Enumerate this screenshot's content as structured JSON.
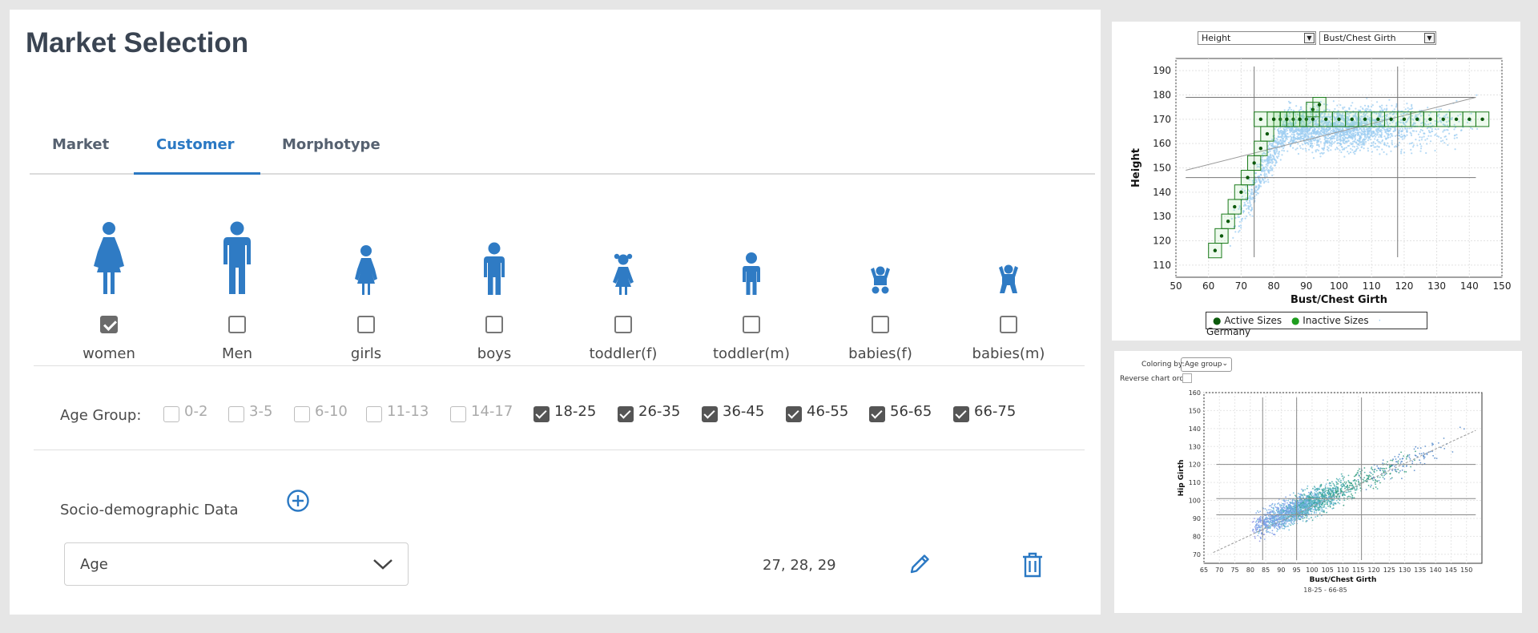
{
  "page": {
    "title": "Market Selection"
  },
  "tabs": [
    {
      "label": "Market",
      "active": false
    },
    {
      "label": "Customer",
      "active": true
    },
    {
      "label": "Morphotype",
      "active": false
    }
  ],
  "customer_types": [
    {
      "label": "women",
      "icon": "woman-icon",
      "checked": true
    },
    {
      "label": "Men",
      "icon": "man-icon",
      "checked": false
    },
    {
      "label": "girls",
      "icon": "girl-icon",
      "checked": false
    },
    {
      "label": "boys",
      "icon": "boy-icon",
      "checked": false
    },
    {
      "label": "toddler(f)",
      "icon": "toddler-girl-icon",
      "checked": false
    },
    {
      "label": "toddler(m)",
      "icon": "toddler-boy-icon",
      "checked": false
    },
    {
      "label": "babies(f)",
      "icon": "baby-girl-icon",
      "checked": false
    },
    {
      "label": "babies(m)",
      "icon": "baby-boy-icon",
      "checked": false
    }
  ],
  "age_group": {
    "label": "Age Group:",
    "options": [
      {
        "label": "0-2",
        "checked": false
      },
      {
        "label": "3-5",
        "checked": false
      },
      {
        "label": "6-10",
        "checked": false
      },
      {
        "label": "11-13",
        "checked": false
      },
      {
        "label": "14-17",
        "checked": false
      },
      {
        "label": "18-25",
        "checked": true
      },
      {
        "label": "26-35",
        "checked": true
      },
      {
        "label": "36-45",
        "checked": true
      },
      {
        "label": "46-55",
        "checked": true
      },
      {
        "label": "56-65",
        "checked": true
      },
      {
        "label": "66-75",
        "checked": true
      }
    ]
  },
  "socio": {
    "label": "Socio-demographic Data",
    "add_icon": "plus-circle-icon",
    "select_value": "Age",
    "values": "27, 28, 29",
    "edit_icon": "pencil-icon",
    "delete_icon": "trash-icon"
  },
  "colors": {
    "accent": "#2a78c3",
    "active_size": "#0c5a0c",
    "inactive_size": "#1e9d1e",
    "population": "#9dcdf2"
  },
  "chart1": {
    "y_select": "Height",
    "x_select": "Bust/Chest Girth",
    "legend": [
      "Active Sizes",
      "Inactive Sizes",
      "Germany"
    ]
  },
  "chart2": {
    "coloring_label": "Coloring by:",
    "coloring_value": "Age group",
    "reverse_label": "Reverse chart order",
    "range_label": "18-25 - 66-85"
  },
  "chart_data": [
    {
      "type": "scatter",
      "xlabel": "Bust/Chest Girth",
      "ylabel": "Height",
      "xlim": [
        50,
        150
      ],
      "ylim": [
        105,
        195
      ],
      "xticks": [
        50,
        60,
        70,
        80,
        90,
        100,
        110,
        120,
        130,
        140,
        150
      ],
      "yticks": [
        110,
        120,
        130,
        140,
        150,
        160,
        170,
        180,
        190
      ],
      "grid": true,
      "legend_position": "bottom",
      "series": [
        {
          "name": "Active Sizes",
          "x": [
            62,
            64,
            66,
            68,
            70,
            72,
            74,
            76,
            78,
            80,
            82,
            84,
            86,
            88,
            90,
            92,
            94,
            76,
            80,
            84,
            88,
            92,
            96,
            100,
            104,
            108,
            112,
            116,
            120,
            124,
            128,
            132,
            136,
            140,
            144
          ],
          "y": [
            116,
            122,
            128,
            134,
            140,
            146,
            152,
            158,
            164,
            170,
            170,
            170,
            170,
            170,
            170,
            174,
            176,
            170,
            170,
            170,
            170,
            170,
            170,
            170,
            170,
            170,
            170,
            170,
            170,
            170,
            170,
            170,
            170,
            170,
            170
          ]
        },
        {
          "name": "Germany",
          "x_range": [
            60,
            145
          ],
          "y_range": [
            110,
            185
          ]
        }
      ],
      "reference_lines": {
        "vertical": [
          74,
          118
        ],
        "horizontal": [
          146,
          179
        ]
      },
      "trend_line": {
        "x": [
          53,
          142
        ],
        "y": [
          149,
          179
        ]
      }
    },
    {
      "type": "scatter",
      "xlabel": "Bust/Chest Girth",
      "ylabel": "Hip Girth",
      "xlim": [
        65,
        155
      ],
      "ylim": [
        65,
        160
      ],
      "xticks": [
        65,
        70,
        75,
        80,
        85,
        90,
        95,
        100,
        105,
        110,
        115,
        120,
        125,
        130,
        135,
        140,
        145,
        150
      ],
      "yticks": [
        70,
        80,
        90,
        100,
        110,
        120,
        130,
        140,
        150,
        160
      ],
      "grid": true,
      "reference_lines": {
        "vertical": [
          84,
          95,
          116
        ],
        "horizontal": [
          92,
          101,
          120
        ]
      },
      "trend_line": {
        "x": [
          68,
          153
        ],
        "y": [
          71,
          139
        ]
      }
    }
  ]
}
